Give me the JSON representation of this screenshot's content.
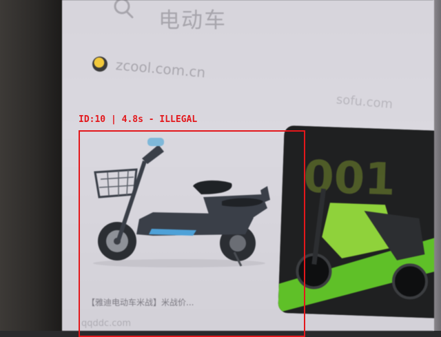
{
  "search": {
    "query": "电动车"
  },
  "results": {
    "source_domain": "zcool.com.cn",
    "secondary_domain": "sofu.com",
    "card_1": {
      "caption": "【雅迪电动车米战】米战价...",
      "domain": "qqddc.com"
    }
  },
  "detection": {
    "label": "ID:10 | 4.8s - ILLEGAL",
    "color": "#e3171b"
  },
  "colors": {
    "screen_bg": "#d7d5dc",
    "scooter_frame": "#3a3f48",
    "scooter_accent": "#4ea1d8",
    "card2_green": "#8fd23b"
  }
}
